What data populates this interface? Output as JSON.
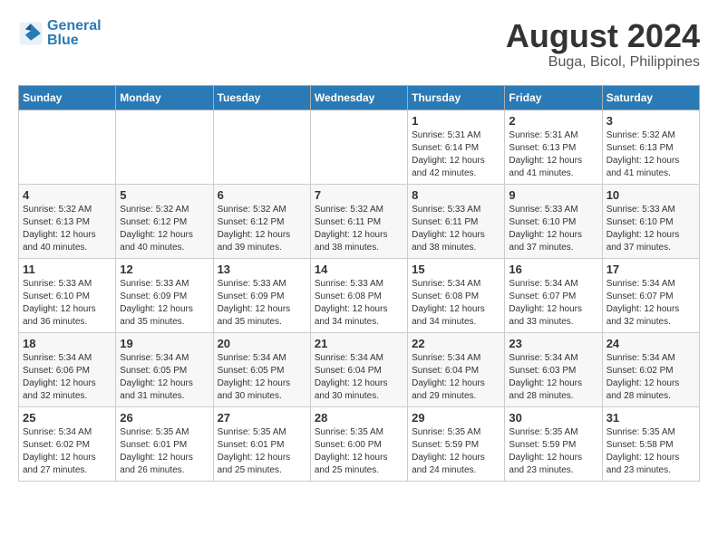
{
  "logo": {
    "line1": "General",
    "line2": "Blue"
  },
  "title": "August 2024",
  "subtitle": "Buga, Bicol, Philippines",
  "days_of_week": [
    "Sunday",
    "Monday",
    "Tuesday",
    "Wednesday",
    "Thursday",
    "Friday",
    "Saturday"
  ],
  "weeks": [
    [
      {
        "day": "",
        "info": ""
      },
      {
        "day": "",
        "info": ""
      },
      {
        "day": "",
        "info": ""
      },
      {
        "day": "",
        "info": ""
      },
      {
        "day": "1",
        "info": "Sunrise: 5:31 AM\nSunset: 6:14 PM\nDaylight: 12 hours\nand 42 minutes."
      },
      {
        "day": "2",
        "info": "Sunrise: 5:31 AM\nSunset: 6:13 PM\nDaylight: 12 hours\nand 41 minutes."
      },
      {
        "day": "3",
        "info": "Sunrise: 5:32 AM\nSunset: 6:13 PM\nDaylight: 12 hours\nand 41 minutes."
      }
    ],
    [
      {
        "day": "4",
        "info": "Sunrise: 5:32 AM\nSunset: 6:13 PM\nDaylight: 12 hours\nand 40 minutes."
      },
      {
        "day": "5",
        "info": "Sunrise: 5:32 AM\nSunset: 6:12 PM\nDaylight: 12 hours\nand 40 minutes."
      },
      {
        "day": "6",
        "info": "Sunrise: 5:32 AM\nSunset: 6:12 PM\nDaylight: 12 hours\nand 39 minutes."
      },
      {
        "day": "7",
        "info": "Sunrise: 5:32 AM\nSunset: 6:11 PM\nDaylight: 12 hours\nand 38 minutes."
      },
      {
        "day": "8",
        "info": "Sunrise: 5:33 AM\nSunset: 6:11 PM\nDaylight: 12 hours\nand 38 minutes."
      },
      {
        "day": "9",
        "info": "Sunrise: 5:33 AM\nSunset: 6:10 PM\nDaylight: 12 hours\nand 37 minutes."
      },
      {
        "day": "10",
        "info": "Sunrise: 5:33 AM\nSunset: 6:10 PM\nDaylight: 12 hours\nand 37 minutes."
      }
    ],
    [
      {
        "day": "11",
        "info": "Sunrise: 5:33 AM\nSunset: 6:10 PM\nDaylight: 12 hours\nand 36 minutes."
      },
      {
        "day": "12",
        "info": "Sunrise: 5:33 AM\nSunset: 6:09 PM\nDaylight: 12 hours\nand 35 minutes."
      },
      {
        "day": "13",
        "info": "Sunrise: 5:33 AM\nSunset: 6:09 PM\nDaylight: 12 hours\nand 35 minutes."
      },
      {
        "day": "14",
        "info": "Sunrise: 5:33 AM\nSunset: 6:08 PM\nDaylight: 12 hours\nand 34 minutes."
      },
      {
        "day": "15",
        "info": "Sunrise: 5:34 AM\nSunset: 6:08 PM\nDaylight: 12 hours\nand 34 minutes."
      },
      {
        "day": "16",
        "info": "Sunrise: 5:34 AM\nSunset: 6:07 PM\nDaylight: 12 hours\nand 33 minutes."
      },
      {
        "day": "17",
        "info": "Sunrise: 5:34 AM\nSunset: 6:07 PM\nDaylight: 12 hours\nand 32 minutes."
      }
    ],
    [
      {
        "day": "18",
        "info": "Sunrise: 5:34 AM\nSunset: 6:06 PM\nDaylight: 12 hours\nand 32 minutes."
      },
      {
        "day": "19",
        "info": "Sunrise: 5:34 AM\nSunset: 6:05 PM\nDaylight: 12 hours\nand 31 minutes."
      },
      {
        "day": "20",
        "info": "Sunrise: 5:34 AM\nSunset: 6:05 PM\nDaylight: 12 hours\nand 30 minutes."
      },
      {
        "day": "21",
        "info": "Sunrise: 5:34 AM\nSunset: 6:04 PM\nDaylight: 12 hours\nand 30 minutes."
      },
      {
        "day": "22",
        "info": "Sunrise: 5:34 AM\nSunset: 6:04 PM\nDaylight: 12 hours\nand 29 minutes."
      },
      {
        "day": "23",
        "info": "Sunrise: 5:34 AM\nSunset: 6:03 PM\nDaylight: 12 hours\nand 28 minutes."
      },
      {
        "day": "24",
        "info": "Sunrise: 5:34 AM\nSunset: 6:02 PM\nDaylight: 12 hours\nand 28 minutes."
      }
    ],
    [
      {
        "day": "25",
        "info": "Sunrise: 5:34 AM\nSunset: 6:02 PM\nDaylight: 12 hours\nand 27 minutes."
      },
      {
        "day": "26",
        "info": "Sunrise: 5:35 AM\nSunset: 6:01 PM\nDaylight: 12 hours\nand 26 minutes."
      },
      {
        "day": "27",
        "info": "Sunrise: 5:35 AM\nSunset: 6:01 PM\nDaylight: 12 hours\nand 25 minutes."
      },
      {
        "day": "28",
        "info": "Sunrise: 5:35 AM\nSunset: 6:00 PM\nDaylight: 12 hours\nand 25 minutes."
      },
      {
        "day": "29",
        "info": "Sunrise: 5:35 AM\nSunset: 5:59 PM\nDaylight: 12 hours\nand 24 minutes."
      },
      {
        "day": "30",
        "info": "Sunrise: 5:35 AM\nSunset: 5:59 PM\nDaylight: 12 hours\nand 23 minutes."
      },
      {
        "day": "31",
        "info": "Sunrise: 5:35 AM\nSunset: 5:58 PM\nDaylight: 12 hours\nand 23 minutes."
      }
    ]
  ]
}
